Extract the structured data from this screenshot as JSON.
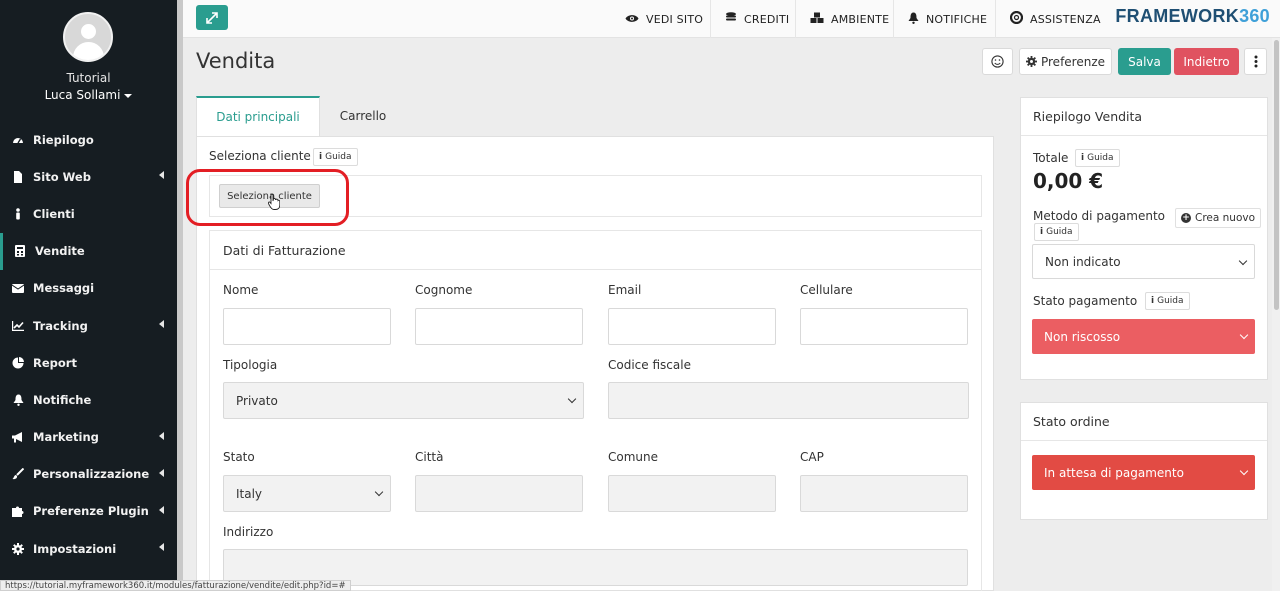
{
  "sidebar": {
    "org": "Tutorial",
    "user": "Luca Sollami",
    "items": [
      {
        "label": "Riepilogo",
        "icon": "dashboard-icon",
        "has_children": false
      },
      {
        "label": "Sito Web",
        "icon": "file-icon",
        "has_children": true
      },
      {
        "label": "Clienti",
        "icon": "person-icon",
        "has_children": false
      },
      {
        "label": "Vendite",
        "icon": "calculator-icon",
        "has_children": false,
        "active": true
      },
      {
        "label": "Messaggi",
        "icon": "envelope-icon",
        "has_children": false
      },
      {
        "label": "Tracking",
        "icon": "chart-icon",
        "has_children": true
      },
      {
        "label": "Report",
        "icon": "pie-icon",
        "has_children": false
      },
      {
        "label": "Notifiche",
        "icon": "bell-icon",
        "has_children": false
      },
      {
        "label": "Marketing",
        "icon": "megaphone-icon",
        "has_children": true
      },
      {
        "label": "Personalizzazione",
        "icon": "brush-icon",
        "has_children": true
      },
      {
        "label": "Preferenze Plugin",
        "icon": "puzzle-icon",
        "has_children": true
      },
      {
        "label": "Impostazioni",
        "icon": "gear-icon",
        "has_children": true
      }
    ]
  },
  "topbar": {
    "links": [
      {
        "label": "VEDI SITO",
        "icon": "eye-icon"
      },
      {
        "label": "CREDITI",
        "icon": "coins-icon"
      },
      {
        "label": "AMBIENTE",
        "icon": "cubes-icon"
      },
      {
        "label": "NOTIFICHE",
        "icon": "bell-icon"
      },
      {
        "label": "ASSISTENZA",
        "icon": "lifebuoy-icon"
      }
    ],
    "brand_main": "FRAMEWORK",
    "brand_accent": "360"
  },
  "page": {
    "title": "Vendita",
    "preferences": "Preferenze",
    "save": "Salva",
    "back": "Indietro"
  },
  "tabs": {
    "main": "Dati principali",
    "cart": "Carrello"
  },
  "client": {
    "label": "Seleziona cliente",
    "help": "Guida",
    "button": "Seleziona cliente"
  },
  "billing": {
    "title": "Dati di Fatturazione",
    "nome": "Nome",
    "cognome": "Cognome",
    "email": "Email",
    "cellulare": "Cellulare",
    "tipologia": "Tipologia",
    "tipologia_value": "Privato",
    "codice_fiscale": "Codice fiscale",
    "stato": "Stato",
    "stato_value": "Italy",
    "citta": "Città",
    "comune": "Comune",
    "cap": "CAP",
    "indirizzo": "Indirizzo"
  },
  "summary": {
    "title": "Riepilogo Vendita",
    "total_label": "Totale",
    "help": "Guida",
    "total_value": "0,00 €",
    "payment_method_label": "Metodo di pagamento",
    "create_new": "Crea nuovo",
    "payment_method_value": "Non indicato",
    "payment_status_label": "Stato pagamento",
    "payment_status_value": "Non riscosso"
  },
  "order": {
    "title": "Stato ordine",
    "status_value": "In attesa di pagamento"
  },
  "status_bar": "https://tutorial.myframework360.it/modules/fatturazione/vendite/edit.php?id=#",
  "colors": {
    "accent": "#2a9d8f",
    "danger": "#e05260",
    "sidebar": "#161d22"
  }
}
